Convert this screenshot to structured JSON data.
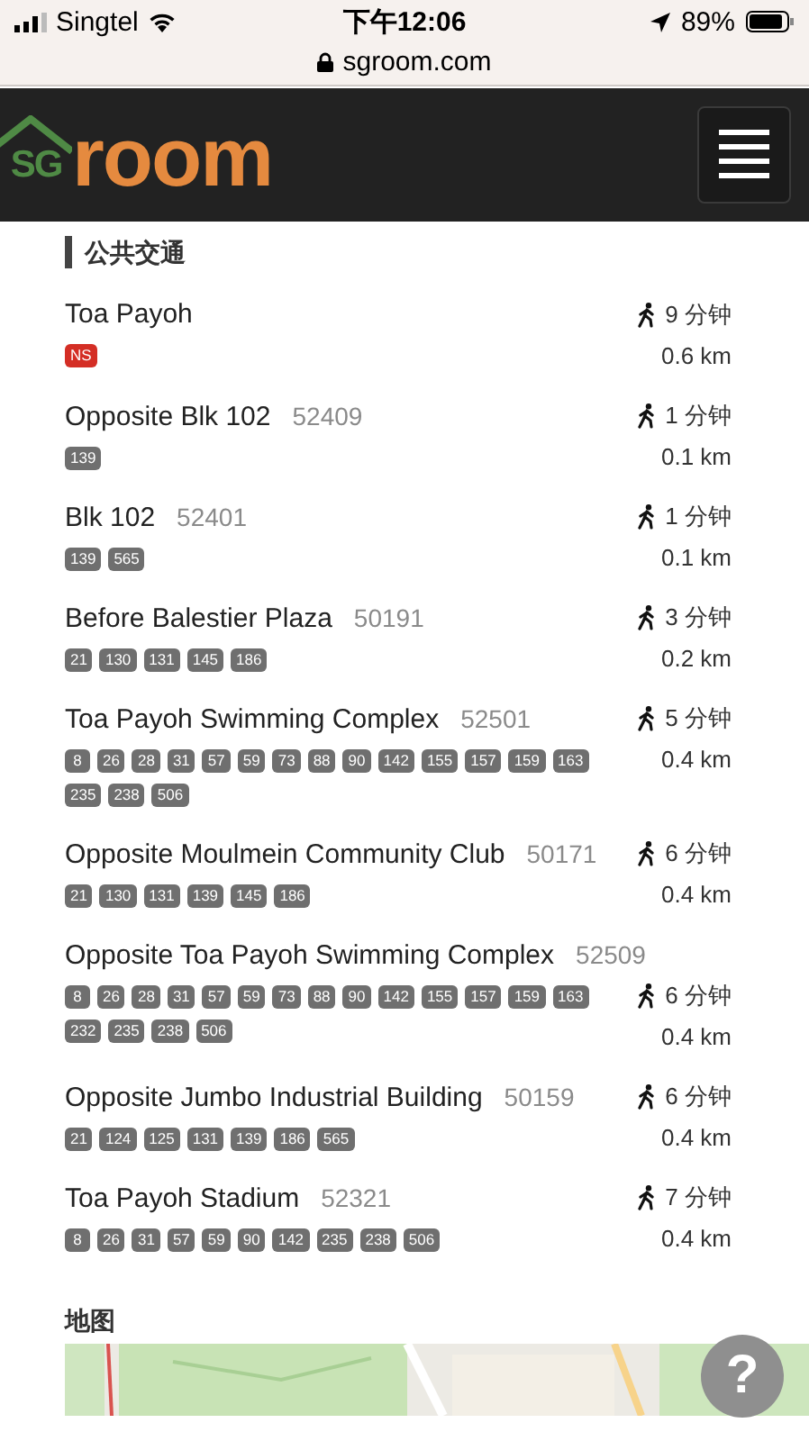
{
  "status_bar": {
    "carrier": "Singtel",
    "time": "下午12:06",
    "battery": "89%",
    "url": "sgroom.com"
  },
  "header": {
    "logo": {
      "prefix": "SG",
      "text": "room"
    }
  },
  "section": {
    "title": "公共交通"
  },
  "stops": [
    {
      "name": "Toa Payoh",
      "lines": [
        {
          "label": "NS",
          "kind": "mrt"
        }
      ],
      "walk": "9 分钟",
      "distance": "0.6 km"
    },
    {
      "name": "Opposite Blk 102",
      "code": "52409",
      "lines": [
        {
          "label": "139",
          "kind": "bus"
        }
      ],
      "walk": "1 分钟",
      "distance": "0.1 km"
    },
    {
      "name": "Blk 102",
      "code": "52401",
      "lines": [
        {
          "label": "139",
          "kind": "bus"
        },
        {
          "label": "565",
          "kind": "bus"
        }
      ],
      "walk": "1 分钟",
      "distance": "0.1 km"
    },
    {
      "name": "Before Balestier Plaza",
      "code": "50191",
      "lines": [
        {
          "label": "21",
          "kind": "bus"
        },
        {
          "label": "130",
          "kind": "bus"
        },
        {
          "label": "131",
          "kind": "bus"
        },
        {
          "label": "145",
          "kind": "bus"
        },
        {
          "label": "186",
          "kind": "bus"
        }
      ],
      "walk": "3 分钟",
      "distance": "0.2 km"
    },
    {
      "name": "Toa Payoh Swimming Complex",
      "code": "52501",
      "lines": [
        {
          "label": "8",
          "kind": "bus"
        },
        {
          "label": "26",
          "kind": "bus"
        },
        {
          "label": "28",
          "kind": "bus"
        },
        {
          "label": "31",
          "kind": "bus"
        },
        {
          "label": "57",
          "kind": "bus"
        },
        {
          "label": "59",
          "kind": "bus"
        },
        {
          "label": "73",
          "kind": "bus"
        },
        {
          "label": "88",
          "kind": "bus"
        },
        {
          "label": "90",
          "kind": "bus"
        },
        {
          "label": "142",
          "kind": "bus"
        },
        {
          "label": "155",
          "kind": "bus"
        },
        {
          "label": "157",
          "kind": "bus"
        },
        {
          "label": "159",
          "kind": "bus"
        },
        {
          "label": "163",
          "kind": "bus"
        },
        {
          "label": "235",
          "kind": "bus"
        },
        {
          "label": "238",
          "kind": "bus"
        },
        {
          "label": "506",
          "kind": "bus"
        }
      ],
      "walk": "5 分钟",
      "distance": "0.4 km"
    },
    {
      "name": "Opposite Moulmein Community Club",
      "code": "50171",
      "lines": [
        {
          "label": "21",
          "kind": "bus"
        },
        {
          "label": "130",
          "kind": "bus"
        },
        {
          "label": "131",
          "kind": "bus"
        },
        {
          "label": "139",
          "kind": "bus"
        },
        {
          "label": "145",
          "kind": "bus"
        },
        {
          "label": "186",
          "kind": "bus"
        }
      ],
      "walk": "6 分钟",
      "distance": "0.4 km"
    },
    {
      "name": "Opposite Toa Payoh Swimming Complex",
      "code": "52509",
      "lines": [
        {
          "label": "8",
          "kind": "bus"
        },
        {
          "label": "26",
          "kind": "bus"
        },
        {
          "label": "28",
          "kind": "bus"
        },
        {
          "label": "31",
          "kind": "bus"
        },
        {
          "label": "57",
          "kind": "bus"
        },
        {
          "label": "59",
          "kind": "bus"
        },
        {
          "label": "73",
          "kind": "bus"
        },
        {
          "label": "88",
          "kind": "bus"
        },
        {
          "label": "90",
          "kind": "bus"
        },
        {
          "label": "142",
          "kind": "bus"
        },
        {
          "label": "155",
          "kind": "bus"
        },
        {
          "label": "157",
          "kind": "bus"
        },
        {
          "label": "159",
          "kind": "bus"
        },
        {
          "label": "163",
          "kind": "bus"
        },
        {
          "label": "232",
          "kind": "bus"
        },
        {
          "label": "235",
          "kind": "bus"
        },
        {
          "label": "238",
          "kind": "bus"
        },
        {
          "label": "506",
          "kind": "bus"
        }
      ],
      "walk": "6 分钟",
      "distance": "0.4 km"
    },
    {
      "name": "Opposite Jumbo Industrial Building",
      "code": "50159",
      "lines": [
        {
          "label": "21",
          "kind": "bus"
        },
        {
          "label": "124",
          "kind": "bus"
        },
        {
          "label": "125",
          "kind": "bus"
        },
        {
          "label": "131",
          "kind": "bus"
        },
        {
          "label": "139",
          "kind": "bus"
        },
        {
          "label": "186",
          "kind": "bus"
        },
        {
          "label": "565",
          "kind": "bus"
        }
      ],
      "walk": "6 分钟",
      "distance": "0.4 km"
    },
    {
      "name": "Toa Payoh Stadium",
      "code": "52321",
      "lines": [
        {
          "label": "8",
          "kind": "bus"
        },
        {
          "label": "26",
          "kind": "bus"
        },
        {
          "label": "31",
          "kind": "bus"
        },
        {
          "label": "57",
          "kind": "bus"
        },
        {
          "label": "59",
          "kind": "bus"
        },
        {
          "label": "90",
          "kind": "bus"
        },
        {
          "label": "142",
          "kind": "bus"
        },
        {
          "label": "235",
          "kind": "bus"
        },
        {
          "label": "238",
          "kind": "bus"
        },
        {
          "label": "506",
          "kind": "bus"
        }
      ],
      "walk": "7 分钟",
      "distance": "0.4 km"
    }
  ],
  "map_section": {
    "title": "地图"
  },
  "help_button": {
    "label": "?"
  }
}
